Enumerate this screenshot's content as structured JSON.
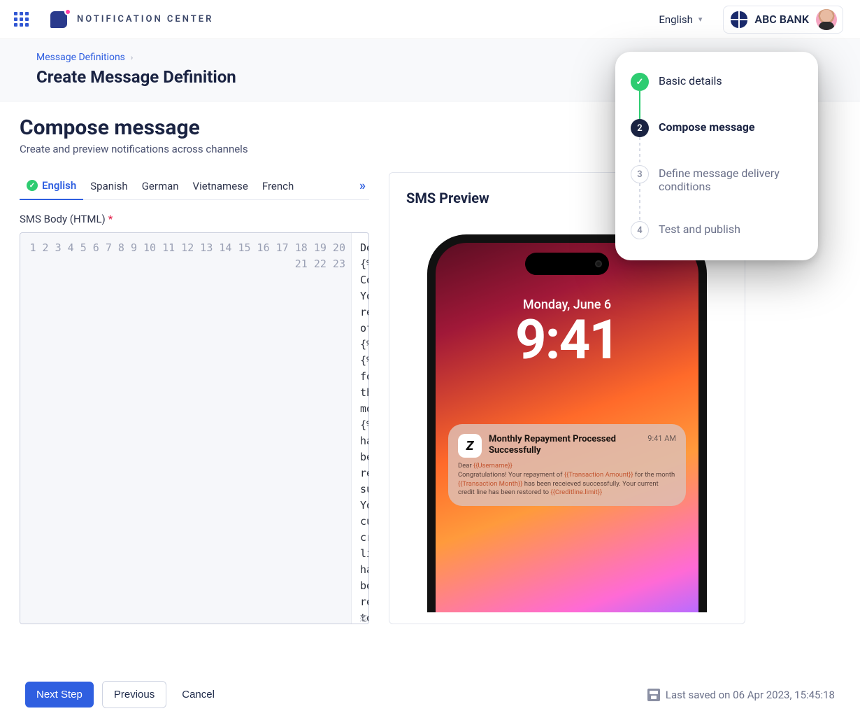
{
  "header": {
    "brand": "NOTIFICATION CENTER",
    "language": "English",
    "org_name": "ABC BANK"
  },
  "breadcrumb": {
    "parent": "Message Definitions",
    "current": "Create Message Definition"
  },
  "section": {
    "title": "Compose message",
    "subtitle": "Create and preview notifications across channels"
  },
  "editor": {
    "tabs": [
      "English",
      "Spanish",
      "German",
      "Vietnamese",
      "French"
    ],
    "active_tab_index": 0,
    "field_label": "SMS Body (HTML)",
    "line_count": 23,
    "code": "Dear {%=accountholder.name},\nCongratulations! Your repayment of\n{%=value.currency%} {%=amount%} for the\nmonth {%=transactionDate.month%} has been\nreceived successfully. Your current credit\nline has been restored to\n{%=value.currency%} {%=attributes['super-\ncard.limit']%}"
  },
  "preview": {
    "title": "SMS Preview",
    "lock_date": "Monday, June 6",
    "lock_time": "9:41",
    "notif_title": "Monthly Repayment Processed Successfully",
    "notif_time": "9:41 AM",
    "notif_body_plain": "Dear {{Username}}",
    "notif_line2_pre": "Congratulations! Your repayment of ",
    "notif_tok_amount": "{{Transaction Amount}}",
    "notif_line2_mid": " for the month ",
    "notif_tok_month": "{{Transaction Month}}",
    "notif_line2_post": " has been receieved successfully. Your current credit line has been restored to ",
    "notif_tok_limit": "{{Creditline.limit}}",
    "notif_tok_user": "{{Username}}",
    "notif_dear": "Dear "
  },
  "stepper": {
    "steps": [
      {
        "label": "Basic details",
        "state": "done"
      },
      {
        "label": "Compose message",
        "state": "current",
        "num": "2"
      },
      {
        "label": "Define message delivery conditions",
        "state": "pending",
        "num": "3"
      },
      {
        "label": "Test and publish",
        "state": "pending",
        "num": "4"
      }
    ]
  },
  "footer": {
    "next": "Next Step",
    "previous": "Previous",
    "cancel": "Cancel",
    "saved": "Last saved on 06 Apr 2023, 15:45:18"
  }
}
